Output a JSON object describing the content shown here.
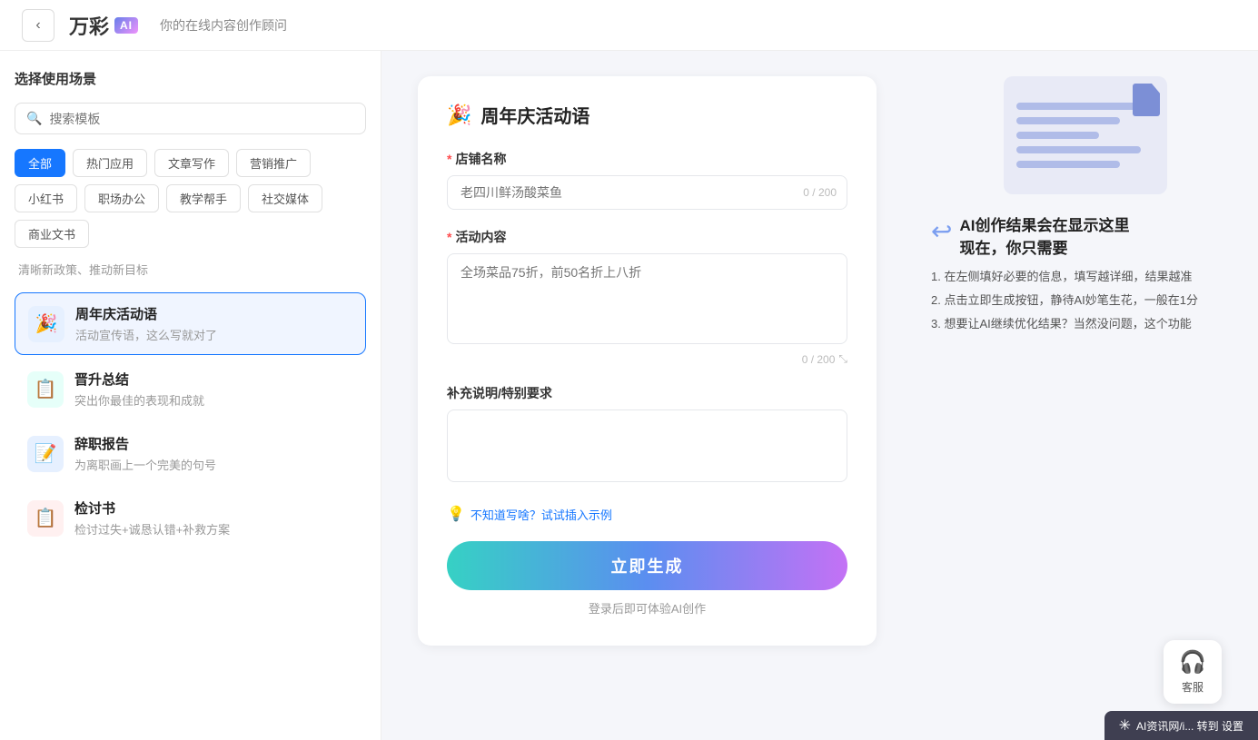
{
  "header": {
    "back_label": "‹",
    "logo_text": "万彩",
    "logo_badge": "AI",
    "subtitle": "你的在线内容创作顾问"
  },
  "sidebar": {
    "title": "选择使用场景",
    "search_placeholder": "搜索模板",
    "tags": [
      {
        "label": "全部",
        "active": true
      },
      {
        "label": "热门应用",
        "active": false
      },
      {
        "label": "文章写作",
        "active": false
      },
      {
        "label": "营销推广",
        "active": false
      },
      {
        "label": "小红书",
        "active": false
      },
      {
        "label": "职场办公",
        "active": false
      },
      {
        "label": "教学帮手",
        "active": false
      },
      {
        "label": "社交媒体",
        "active": false
      },
      {
        "label": "商业文书",
        "active": false
      }
    ],
    "section_label": "清晰新政策、推动新目标",
    "templates": [
      {
        "id": "anniversary",
        "icon": "🎉",
        "icon_class": "blue",
        "name": "周年庆活动语",
        "desc": "活动宣传语，这么写就对了",
        "active": true
      },
      {
        "id": "promotion",
        "icon": "📋",
        "icon_class": "teal",
        "name": "晋升总结",
        "desc": "突出你最佳的表现和成就",
        "active": false
      },
      {
        "id": "resignation",
        "icon": "📝",
        "icon_class": "blue",
        "name": "辞职报告",
        "desc": "为离职画上一个完美的句号",
        "active": false
      },
      {
        "id": "review",
        "icon": "📋",
        "icon_class": "red",
        "name": "检讨书",
        "desc": "检讨过失+诚恳认错+补救方案",
        "active": false
      }
    ]
  },
  "form": {
    "title": "周年庆活动语",
    "title_icon": "🎉",
    "field_store_name": {
      "label": "店铺名称",
      "required": true,
      "placeholder": "老四川鲜汤酸菜鱼",
      "counter": "0 / 200"
    },
    "field_activity": {
      "label": "活动内容",
      "required": true,
      "placeholder": "全场菜品75折，前50名折上八折",
      "counter": "0 / 200"
    },
    "field_supplement": {
      "label": "补充说明/特别要求",
      "required": false,
      "placeholder": ""
    },
    "hint_icon": "💡",
    "hint_text": "不知道写啥？试试插入示例",
    "generate_label": "立即生成",
    "login_hint": "登录后即可体验AI创作"
  },
  "right_panel": {
    "arrow_icon": "↩",
    "result_title_line1": "AI创作结果会在显示这里",
    "result_title_line2": "现在，你只需要",
    "tips": [
      "1. 在左侧填好必要的信息，填写越详细，结果越准",
      "2. 点击立即生成按钮，静待AI妙笔生花，一般在1分",
      "3. 想要让AI继续优化结果？当然没问题，这个功能"
    ]
  },
  "customer_service": {
    "icon": "🎧",
    "label": "客服"
  },
  "watermark": {
    "icon": "✳",
    "text": "AI资讯网/i... 转到 设置"
  }
}
